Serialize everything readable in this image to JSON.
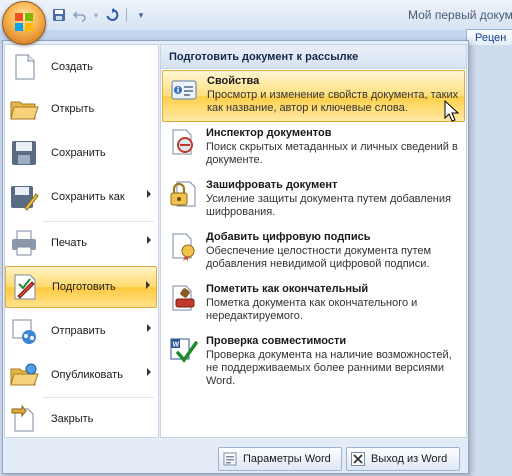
{
  "window": {
    "title": "Мой первый докуме",
    "ribbon_tab_partial": "Рецен"
  },
  "qat": {
    "save_icon": "floppy-icon",
    "undo_icon": "undo-icon",
    "redo_icon": "redo-icon",
    "customize_icon": "customize-qat-icon"
  },
  "menu": {
    "items": [
      {
        "label": "Создать",
        "icon": "new-document-icon",
        "submenu": false
      },
      {
        "label": "Открыть",
        "icon": "open-folder-icon",
        "submenu": false
      },
      {
        "label": "Сохранить",
        "icon": "save-icon",
        "submenu": false
      },
      {
        "label": "Сохранить как",
        "icon": "save-as-icon",
        "submenu": true
      },
      {
        "label": "Печать",
        "icon": "printer-icon",
        "submenu": true
      },
      {
        "label": "Подготовить",
        "icon": "prepare-icon",
        "submenu": true,
        "active": true
      },
      {
        "label": "Отправить",
        "icon": "send-icon",
        "submenu": true
      },
      {
        "label": "Опубликовать",
        "icon": "publish-icon",
        "submenu": true
      },
      {
        "label": "Закрыть",
        "icon": "close-document-icon",
        "submenu": false
      }
    ]
  },
  "submenu": {
    "header": "Подготовить документ к рассылке",
    "items": [
      {
        "title": "Свойства",
        "description": "Просмотр и изменение свойств документа, таких как название, автор и ключевые слова.",
        "icon": "properties-icon",
        "active": true
      },
      {
        "title": "Инспектор документов",
        "description": "Поиск скрытых метаданных и личных сведений в документе.",
        "icon": "inspector-icon"
      },
      {
        "title": "Зашифровать документ",
        "description": "Усиление защиты документа путем добавления шифрования.",
        "icon": "encrypt-icon"
      },
      {
        "title": "Добавить цифровую подпись",
        "description": "Обеспечение целостности документа путем добавления невидимой цифровой подписи.",
        "icon": "digital-signature-icon"
      },
      {
        "title": "Пометить как окончательный",
        "description": "Пометка документа как окончательного и нередактируемого.",
        "icon": "mark-final-icon"
      },
      {
        "title": "Проверка совместимости",
        "description": "Проверка документа на наличие возможностей, не поддерживаемых более ранними версиями Word.",
        "icon": "compatibility-check-icon"
      }
    ]
  },
  "buttons": {
    "options": "Параметры Word",
    "exit": "Выход из Word"
  },
  "colors": {
    "highlight": "#ffd96b",
    "accent": "#15428b"
  }
}
